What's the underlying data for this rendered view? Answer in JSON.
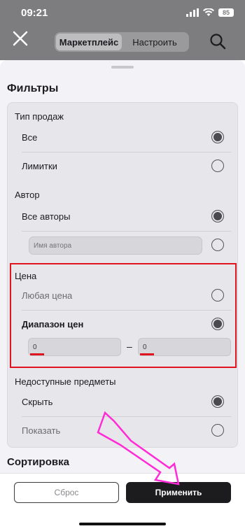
{
  "status_bar": {
    "time": "09:21",
    "battery": "85"
  },
  "header": {
    "tabs": [
      {
        "label": "Маркетплейс",
        "active": true
      },
      {
        "label": "Настроить",
        "active": false
      }
    ]
  },
  "sheet": {
    "title": "Фильтры",
    "sale_type": {
      "label": "Тип продаж",
      "options": [
        {
          "label": "Все",
          "selected": true
        },
        {
          "label": "Лимитки",
          "selected": false
        }
      ]
    },
    "author": {
      "label": "Автор",
      "options": [
        {
          "label": "Все авторы",
          "selected": true
        }
      ],
      "name_placeholder": "Имя автора"
    },
    "price": {
      "label": "Цена",
      "options": [
        {
          "label": "Любая цена",
          "selected": false
        },
        {
          "label": "Диапазон цен",
          "selected": true
        }
      ],
      "min_value": "0",
      "max_value": "0",
      "separator": "–"
    },
    "unavailable": {
      "label": "Недоступные предметы",
      "options": [
        {
          "label": "Скрыть",
          "selected": true
        },
        {
          "label": "Показать",
          "selected": false
        }
      ]
    },
    "sort_title": "Сортировка"
  },
  "footer": {
    "reset_label": "Сброс",
    "apply_label": "Применить"
  },
  "colors": {
    "highlight": "#e0141e",
    "annotation_arrow": "#ff2bd6",
    "apply_button": "#1c1c1e"
  }
}
